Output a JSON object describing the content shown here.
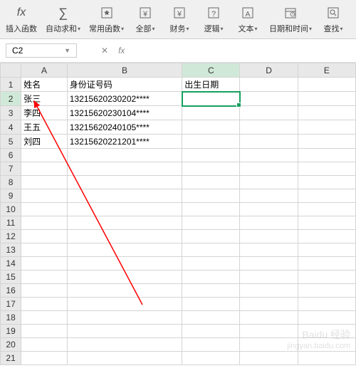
{
  "ribbon": {
    "items": [
      {
        "icon": "fx",
        "label": "插入函数",
        "dropdown": false
      },
      {
        "icon": "sigma",
        "label": "自动求和",
        "dropdown": true
      },
      {
        "icon": "star",
        "label": "常用函数",
        "dropdown": true
      },
      {
        "icon": "yen",
        "label": "全部",
        "dropdown": true
      },
      {
        "icon": "yen",
        "label": "财务",
        "dropdown": true
      },
      {
        "icon": "question",
        "label": "逻辑",
        "dropdown": true
      },
      {
        "icon": "text",
        "label": "文本",
        "dropdown": true
      },
      {
        "icon": "calendar",
        "label": "日期和时间",
        "dropdown": true
      },
      {
        "icon": "search",
        "label": "查找",
        "dropdown": true
      }
    ]
  },
  "namebox": {
    "value": "C2"
  },
  "formula_bar": {
    "fx_label": "fx",
    "value": ""
  },
  "columns": [
    "A",
    "B",
    "C",
    "D",
    "E"
  ],
  "row_count": 21,
  "selected": {
    "col": 2,
    "row": 2
  },
  "cells": {
    "A1": "姓名",
    "B1": "身份证号码",
    "C1": "出生日期",
    "A2": "张三",
    "B2": "13215620230202****",
    "A3": "李四",
    "B3": "13215620230104****",
    "A4": "王五",
    "B4": "13215620240105****",
    "A5": "刘四",
    "B5": "13215620221201****"
  },
  "watermark": {
    "line1": "Baidu 经验",
    "line2": "jingyan.baidu.com"
  }
}
